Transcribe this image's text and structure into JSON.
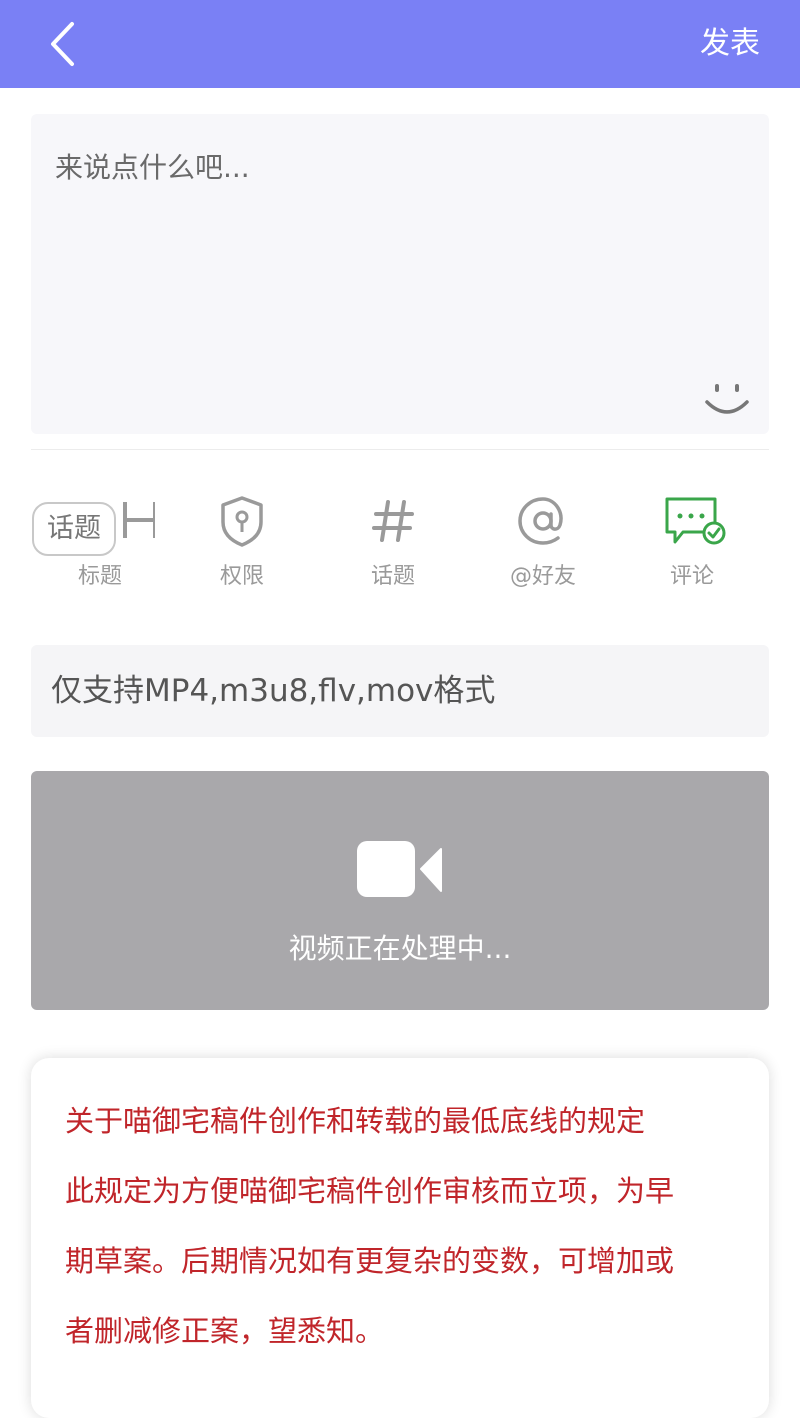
{
  "header": {
    "back_icon": "chevron-left-icon",
    "publish_label": "发表",
    "bg_color": "#7a80f5"
  },
  "editor": {
    "placeholder": "来说点什么吧...",
    "value": "",
    "emoji_icon": "smiley-icon"
  },
  "toolbar": {
    "title": {
      "icon": "heading-h-icon",
      "label": "标题"
    },
    "topic_chip": "话题",
    "permission": {
      "icon": "shield-lock-icon",
      "label": "权限"
    },
    "topic": {
      "icon": "hash-icon",
      "label": "话题"
    },
    "friend": {
      "icon": "at-icon",
      "label": "@好友"
    },
    "comment": {
      "icon": "comment-check-icon",
      "label": "评论",
      "color": "#3aa64a"
    }
  },
  "upload": {
    "format_hint": "仅支持MP4,m3u8,flv,mov格式",
    "status": "视频正在处理中...",
    "icon": "video-camera-icon"
  },
  "notice": {
    "lines": [
      "关于喵御宅稿件创作和转载的最低底线的规定",
      "此规定为方便喵御宅稿件创作审核而立项，为早",
      "期草案。后期情况如有更复杂的变数，可增加或",
      "者删减修正案，望悉知。"
    ],
    "color": "#c0252a"
  }
}
